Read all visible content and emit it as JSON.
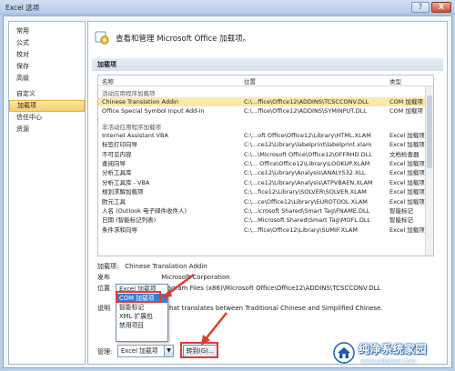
{
  "window": {
    "title": "Excel 选项",
    "help_label": "?",
    "close_label": "X"
  },
  "nav": {
    "items": [
      {
        "label": "常用"
      },
      {
        "label": "公式"
      },
      {
        "label": "校对"
      },
      {
        "label": "保存"
      },
      {
        "label": "高级"
      },
      {
        "label": "自定义"
      },
      {
        "label": "加载项",
        "active": true
      },
      {
        "label": "信任中心"
      },
      {
        "label": "资源"
      }
    ]
  },
  "header": {
    "text": "查看和管理 Microsoft Office 加载项。"
  },
  "section": {
    "title": "加载项"
  },
  "table": {
    "columns": [
      "名称",
      "位置",
      "类型"
    ],
    "active_group": "活动应用程序加载项",
    "active_rows": [
      {
        "name": "Chinese Translation Addin",
        "location": "C:\\...ffice\\Office12\\ADDINS\\TCSCCONV.DLL",
        "type": "COM 加载项"
      },
      {
        "name": "Office Special Symbol Input Add-in",
        "location": "C:\\...ffice\\Office12\\ADDINS\\SYMINPUT.DLL",
        "type": "COM 加载项"
      }
    ],
    "inactive_group": "非活动应用程序加载项",
    "inactive_rows": [
      {
        "name": "Internet Assistant VBA",
        "location": "C:\\...oft Office\\Office12\\Library\\HTML.XLAM",
        "type": "Excel 加载项"
      },
      {
        "name": "标签打印向导",
        "location": "C:\\...ce12\\Library\\labelprint\\labelprint.xlam",
        "type": "Excel 加载项"
      },
      {
        "name": "不可见内容",
        "location": "C:\\...\\Microsoft Office\\Office12\\OFFRHD.DLL",
        "type": "文档检查器"
      },
      {
        "name": "查阅向导",
        "location": "C:\\... Office\\Office12\\Library\\LOOKUP.XLAM",
        "type": "Excel 加载项"
      },
      {
        "name": "分析工具库",
        "location": "C:\\...ce12\\Library\\Analysis\\ANALYS32.XLL",
        "type": "Excel 加载项"
      },
      {
        "name": "分析工具库 - VBA",
        "location": "C:\\...ce12\\Library\\Analysis\\ATPVBAEN.XLAM",
        "type": "Excel 加载项"
      },
      {
        "name": "规划求解加载项",
        "location": "C:\\...fice12\\Library\\SOLVER\\SOLVER.XLAM",
        "type": "Excel 加载项"
      },
      {
        "name": "欧元工具",
        "location": "C:\\...ce\\Office12\\Library\\EUROTOOL.XLAM",
        "type": "Excel 加载项"
      },
      {
        "name": "人名 (Outlook 电子邮件收件人)",
        "location": "C:\\...icrosoft Shared\\Smart Tag\\FNAME.DLL",
        "type": "智能标记"
      },
      {
        "name": "日期 (智能标记列表)",
        "location": "C:\\...Microsoft Shared\\Smart Tag\\MOFL.DLL",
        "type": "智能标记"
      },
      {
        "name": "条件求和向导",
        "location": "C:\\...ffice\\Office12\\Library\\SUMIF.XLAM",
        "type": "Excel 加载项"
      }
    ]
  },
  "details": {
    "addin_label": "加载项:",
    "addin_value": "Chinese Translation Addin",
    "publisher_label": "发布",
    "publisher_value": "Microsoft Corporation",
    "location_label": "位置",
    "location_value": "C:\\Program Files (x86)\\Microsoft Office\\Office12\\ADDINS\\TCSCCONV.DLL",
    "desc_label": "说明",
    "desc_value": "that translates between Traditional Chinese and Simplified Chinese."
  },
  "dropdown": {
    "options": [
      "Excel 加载项",
      "COM 加载项",
      "智能标记",
      "XML 扩展包",
      "禁用项目"
    ],
    "highlighted": "COM 加载项"
  },
  "footer": {
    "manage_label": "管理:",
    "manage_value": "Excel 加载项",
    "goto_label": "转到(G)..."
  },
  "watermark": {
    "name": "纯净系统家园",
    "url": "www.yidaimei.com"
  },
  "colors": {
    "highlight_box": "#e13a2f",
    "selected_row": "#fbe9a9",
    "active_nav": "#f9cf6a"
  }
}
